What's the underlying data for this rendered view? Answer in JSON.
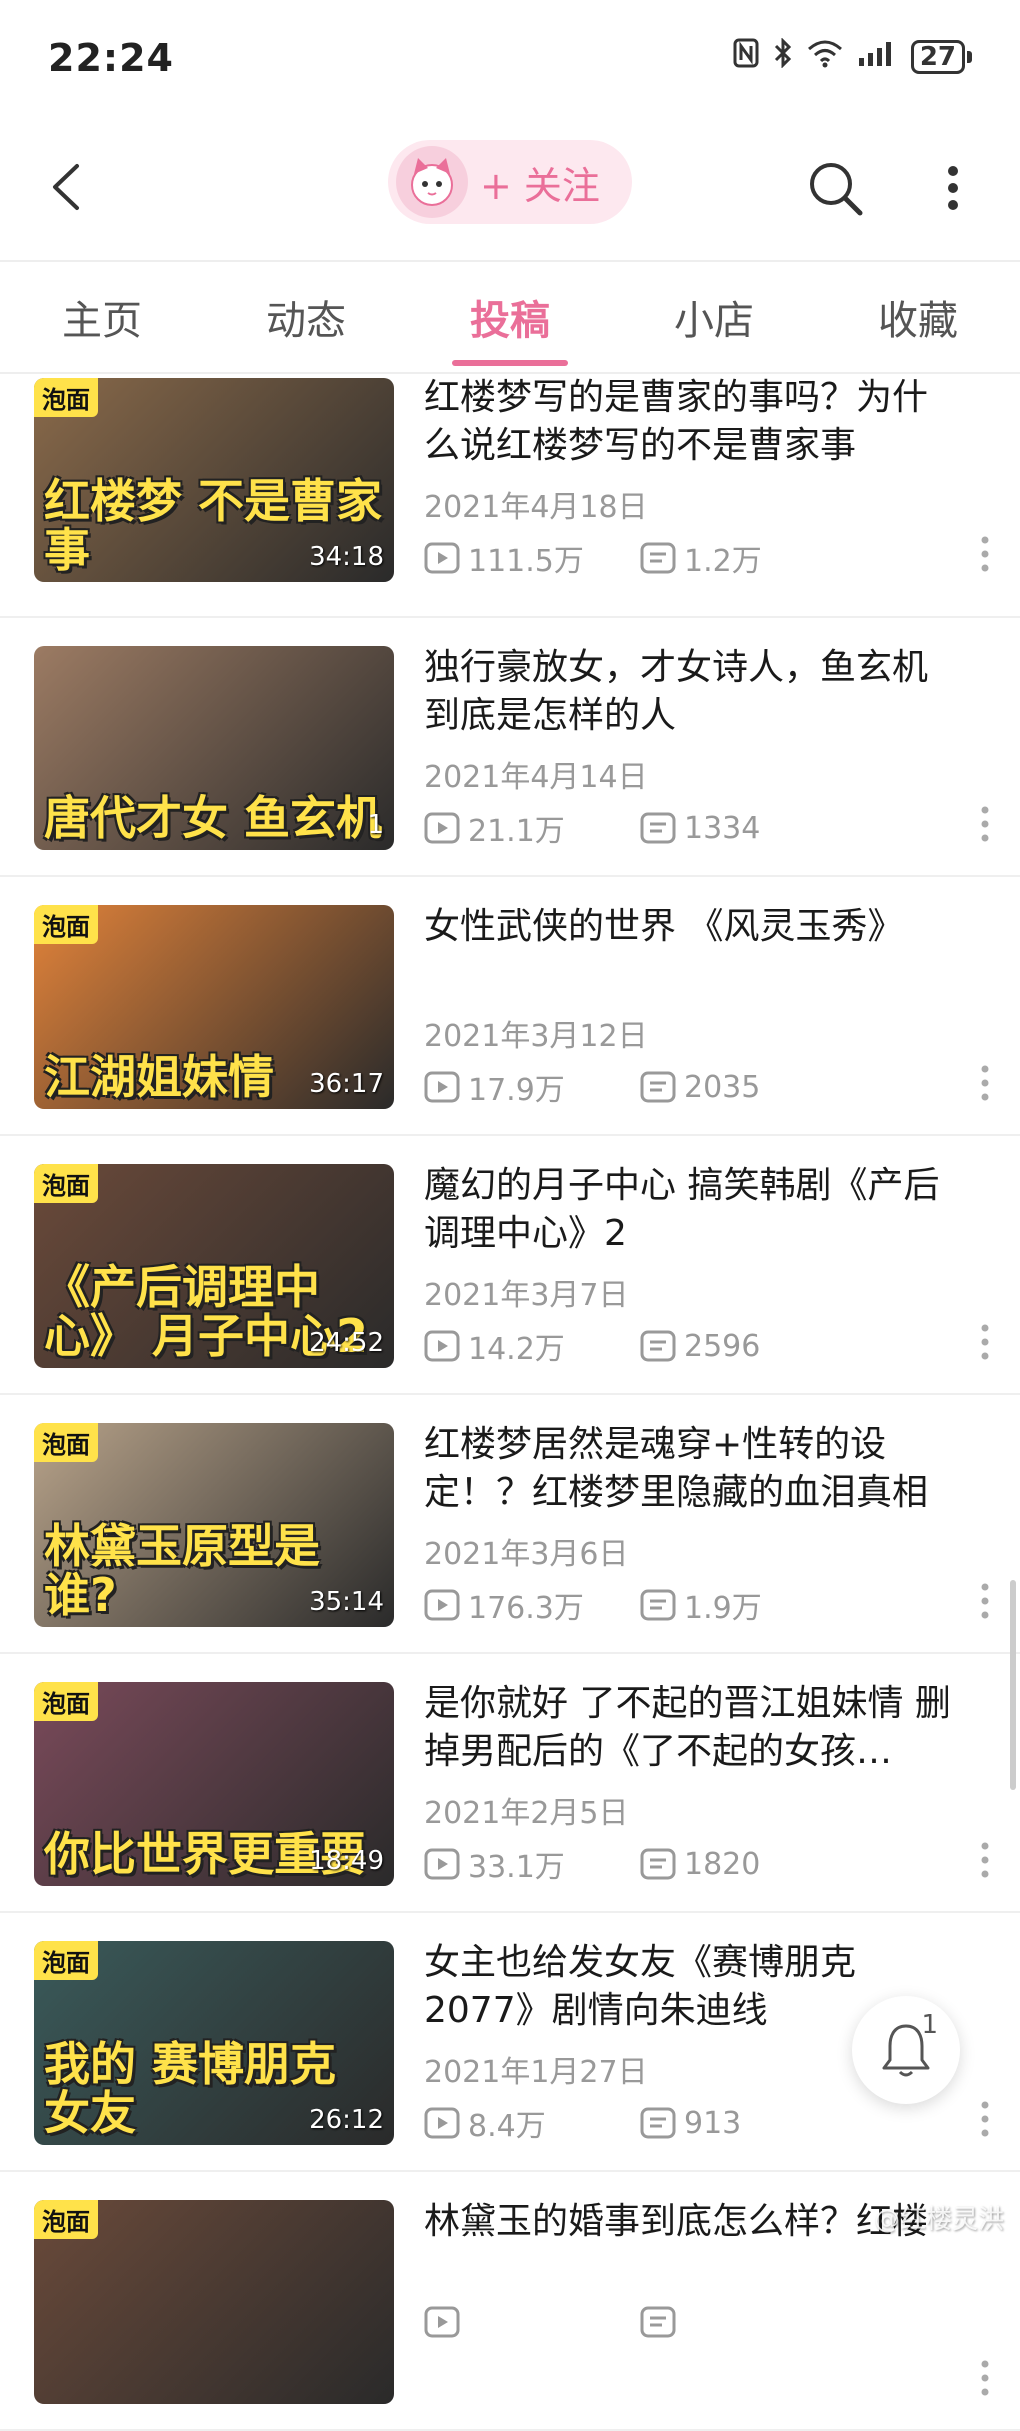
{
  "status_bar": {
    "time": "22:24",
    "battery": "27",
    "icons": [
      "nfc-icon",
      "bluetooth-icon",
      "wifi-icon",
      "signal-icon"
    ]
  },
  "header": {
    "follow_label": "+ 关注"
  },
  "tabs": [
    {
      "label": "主页",
      "active": false
    },
    {
      "label": "动态",
      "active": false
    },
    {
      "label": "投稿",
      "active": true
    },
    {
      "label": "小店",
      "active": false
    },
    {
      "label": "收藏",
      "active": false
    }
  ],
  "videos": [
    {
      "title": "红楼梦写的是曹家的事吗？为什么说红楼梦写的不是曹家事",
      "date": "2021年4月18日",
      "views": "111.5万",
      "comments": "1.2万",
      "duration": "34:18",
      "thumb_text": "红楼梦 不是曹家事",
      "badge": "泡面",
      "thumb_color": "#8a6a4a"
    },
    {
      "title": "独行豪放女，才女诗人，鱼玄机到底是怎样的人",
      "date": "2021年4月14日",
      "views": "21.1万",
      "comments": "1334",
      "duration": "1",
      "thumb_text": "唐代才女 鱼玄机",
      "badge": "",
      "thumb_color": "#9c7b63"
    },
    {
      "title": "女性武侠的世界 《风灵玉秀》",
      "date": "2021年3月12日",
      "views": "17.9万",
      "comments": "2035",
      "duration": "36:17",
      "thumb_text": "江湖姐妹情",
      "badge": "泡面",
      "thumb_color": "#e2833a"
    },
    {
      "title": "魔幻的月子中心 搞笑韩剧《产后调理中心》2",
      "date": "2021年3月7日",
      "views": "14.2万",
      "comments": "2596",
      "duration": "24:52",
      "thumb_text": "《产后调理中心》 月子中心2",
      "badge": "泡面",
      "thumb_color": "#6b4a3a"
    },
    {
      "title": "红楼梦居然是魂穿+性转的设定！？红楼梦里隐藏的血泪真相",
      "date": "2021年3月6日",
      "views": "176.3万",
      "comments": "1.9万",
      "duration": "35:14",
      "thumb_text": "林黛玉原型是谁?",
      "badge": "泡面",
      "thumb_color": "#b8a38a"
    },
    {
      "title": "是你就好 了不起的晋江姐妹情 删掉男配后的《了不起的女孩…",
      "date": "2021年2月5日",
      "views": "33.1万",
      "comments": "1820",
      "duration": "18:49",
      "thumb_text": "你比世界更重要",
      "badge": "泡面",
      "thumb_color": "#7a4a5a"
    },
    {
      "title": "女主也给发女友《赛博朋克2077》剧情向朱迪线",
      "date": "2021年1月27日",
      "views": "8.4万",
      "comments": "913",
      "duration": "26:12",
      "thumb_text": "我的 赛博朋克 女友",
      "badge": "泡面",
      "thumb_color": "#3a5a5a"
    },
    {
      "title": "林黛玉的婚事到底怎么样？红楼",
      "date": "",
      "views": "",
      "comments": "",
      "duration": "",
      "thumb_text": "",
      "badge": "泡面",
      "thumb_color": "#6a4a3a"
    }
  ],
  "notification": {
    "count": "1"
  },
  "watermark": "@红楼灵洪",
  "colors": {
    "accent": "#ea6f99",
    "muted": "#999999"
  }
}
